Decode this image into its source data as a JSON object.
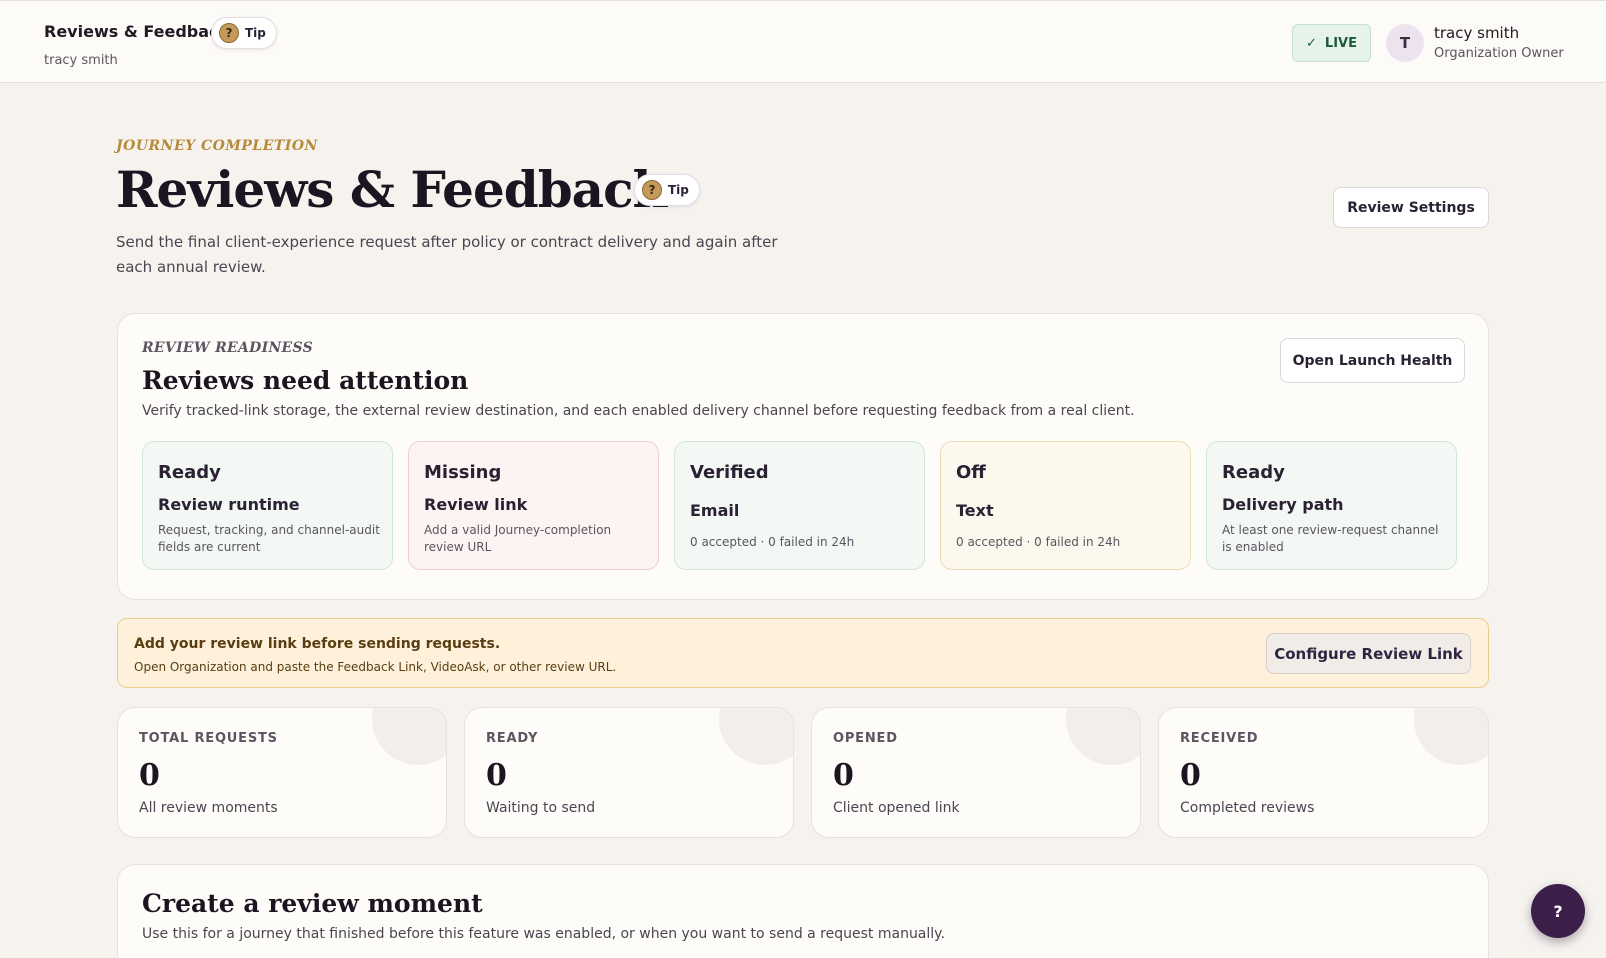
{
  "header": {
    "title": "Reviews & Feedback",
    "tip_label": "Tip",
    "subtitle": "tracy smith",
    "live_label": "LIVE",
    "live_icon": "✓",
    "avatar_initial": "T",
    "user_name": "tracy smith",
    "user_role": "Organization Owner"
  },
  "page": {
    "eyebrow": "JOURNEY COMPLETION",
    "title": "Reviews & Feedback",
    "tip_label": "Tip",
    "description": "Send the final client-experience request after policy or contract delivery and again after each annual review.",
    "settings_button": "Review Settings"
  },
  "readiness": {
    "eyebrow": "REVIEW READINESS",
    "title": "Reviews need attention",
    "description": "Verify tracked-link storage, the external review destination, and each enabled delivery channel before requesting feedback from a real client.",
    "launch_button": "Open Launch Health",
    "tiles": [
      {
        "status": "Ready",
        "name": "Review runtime",
        "detail": "Request, tracking, and channel-audit fields are current",
        "tone": "green"
      },
      {
        "status": "Missing",
        "name": "Review link",
        "detail": "Add a valid Journey-completion review URL",
        "tone": "red"
      },
      {
        "status": "Verified",
        "name": "Email",
        "detail": "0 accepted · 0 failed in 24h",
        "tone": "green"
      },
      {
        "status": "Off",
        "name": "Text",
        "detail": "0 accepted · 0 failed in 24h",
        "tone": "amber"
      },
      {
        "status": "Ready",
        "name": "Delivery path",
        "detail": "At least one review-request channel is enabled",
        "tone": "green"
      }
    ]
  },
  "alert": {
    "title": "Add your review link before sending requests.",
    "description": "Open Organization and paste the Feedback Link, VideoAsk, or other review URL.",
    "button": "Configure Review Link"
  },
  "stats": [
    {
      "label": "TOTAL REQUESTS",
      "value": "0",
      "sub": "All review moments"
    },
    {
      "label": "READY",
      "value": "0",
      "sub": "Waiting to send"
    },
    {
      "label": "OPENED",
      "value": "0",
      "sub": "Client opened link"
    },
    {
      "label": "RECEIVED",
      "value": "0",
      "sub": "Completed reviews"
    }
  ],
  "create": {
    "title": "Create a review moment",
    "description": "Use this for a journey that finished before this feature was enabled, or when you want to send a request manually."
  },
  "help_fab": "?"
}
